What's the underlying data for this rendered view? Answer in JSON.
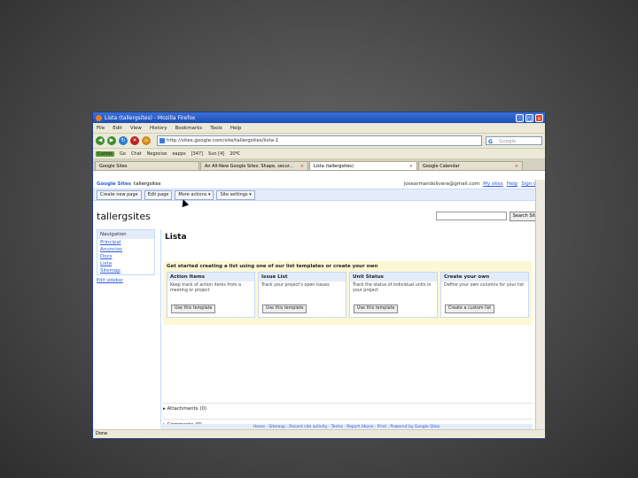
{
  "window": {
    "title": "Lista (tallergsites) - Mozilla Firefox"
  },
  "menu": [
    "File",
    "Edit",
    "View",
    "History",
    "Bookmarks",
    "Tools",
    "Help"
  ],
  "nav": {
    "url": "http://sites.google.com/site/tallergsites/lista-1",
    "search_placeholder": "Google"
  },
  "bookmarks": [
    "Cursos",
    "Go",
    "Chat",
    "Negocios",
    "eapps",
    "[347]",
    "Sun [4]",
    "20ºC"
  ],
  "tabs": [
    {
      "label": "Google Sites"
    },
    {
      "label": "An All-New Google Sites: Shape, secur..."
    },
    {
      "label": "Lista (tallergsites)"
    },
    {
      "label": "Google Calendar"
    }
  ],
  "gsites": {
    "logo": "Google Sites",
    "site": "tallergsites",
    "user": "josearmandolivera@gmail.com",
    "links": [
      "My sites",
      "Help",
      "Sign out"
    ],
    "toolbar": [
      "Create new page",
      "Edit page",
      "More actions ▾",
      "Site settings ▾"
    ],
    "search_button": "Search Site"
  },
  "site_name": "tallergsites",
  "navigation": {
    "title": "Navigation",
    "items": [
      "Principal",
      "Anuncios",
      "Docs",
      "Lista",
      "Sitemap"
    ],
    "edit": "Edit sidebar"
  },
  "page": {
    "title": "Lista",
    "template_header": "Get started creating a list using one of our list templates or create your own",
    "cards": [
      {
        "title": "Action Items",
        "desc": "Keep track of action items from a meeting or project",
        "button": "Use this template"
      },
      {
        "title": "Issue List",
        "desc": "Track your project's open issues",
        "button": "Use this template"
      },
      {
        "title": "Unit Status",
        "desc": "Track the status of individual units in your project",
        "button": "Use this template"
      },
      {
        "title": "Create your own",
        "desc": "Define your own columns for your list",
        "button": "Create a custom list"
      }
    ],
    "attachments": "Attachments (0)",
    "comments": "Comments (0)",
    "footer": "Home · Sitemap · Recent site activity · Terms · Report Abuse · Print · Powered by Google Sites"
  },
  "status": "Done"
}
